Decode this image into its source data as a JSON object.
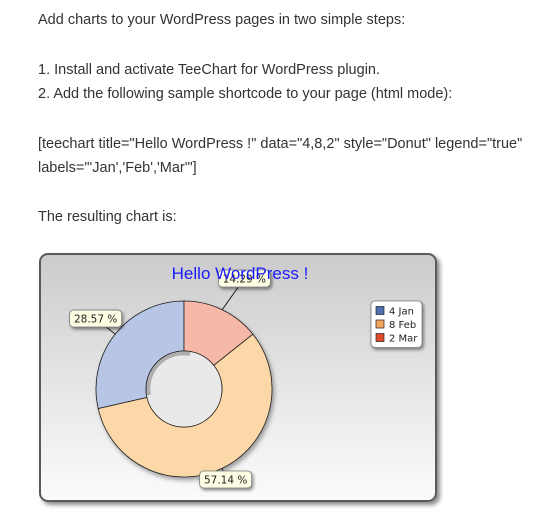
{
  "intro": "Add charts to your WordPress pages in two simple steps:",
  "steps": [
    "1.  Install and activate TeeChart for WordPress plugin.",
    "2. Add the following sample shortcode to your page (html mode):"
  ],
  "shortcode": {
    "line1": "[teechart title=\"Hello WordPress !\" data=\"4,8,2\" style=\"Donut\" legend=\"true\"",
    "line2": "labels=\"'Jan','Feb','Mar'\"]"
  },
  "result_label": "The resulting chart is:",
  "chart_data": {
    "type": "pie",
    "style": "donut",
    "title": "Hello WordPress !",
    "title_color": "#1a1aff",
    "legend_placement": "right",
    "categories": [
      "Jan",
      "Feb",
      "Mar"
    ],
    "values": [
      4,
      8,
      2
    ],
    "legend_entries": [
      "4 Jan",
      "8 Feb",
      "2 Mar"
    ],
    "data_labels": [
      "28.57 %",
      "57.14 %",
      "14.29 %"
    ],
    "colors": [
      "#b8c6e6",
      "#fcd8a8",
      "#f7b9a7"
    ],
    "legend_colors": [
      "#4f6fb5",
      "#f5a55e",
      "#dc4b2a"
    ]
  }
}
